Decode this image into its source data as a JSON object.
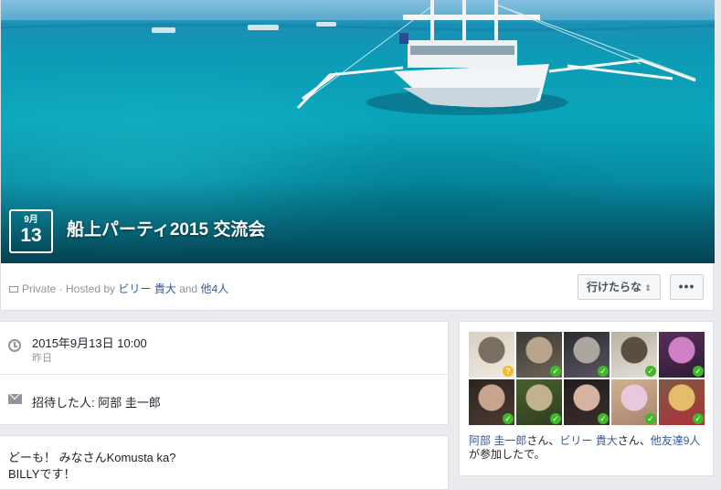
{
  "event": {
    "month": "9月",
    "day": "13",
    "title": "船上パーティ2015 交流会",
    "privacy": "Private · Hosted by",
    "host_name": "ビリー 貴大",
    "host_and": "and",
    "host_others": "他4人",
    "going_button": "行けたらな",
    "going_caret": "⇕",
    "more_button": "•••"
  },
  "details": {
    "date_main": "2015年9月13日 10:00",
    "date_sub": "昨日",
    "invited_by": "招待した人: 阿部 圭一郎"
  },
  "post": {
    "line1": "どーも！ みなさんKomusta ka?",
    "line2": "BILLYです！"
  },
  "friends": {
    "thumbs": [
      {
        "status": "maybe",
        "badge": "?",
        "colors": [
          "#d8d1c2",
          "#7a6f62",
          "#efe9df"
        ]
      },
      {
        "status": "going",
        "badge": "✓",
        "colors": [
          "#3b3a35",
          "#b9a48c",
          "#6c6457"
        ]
      },
      {
        "status": "going",
        "badge": "✓",
        "colors": [
          "#2a2a30",
          "#ada6a0",
          "#5a5660"
        ]
      },
      {
        "status": "going",
        "badge": "✓",
        "colors": [
          "#b7b1a4",
          "#5a4f3f",
          "#e5e1d8"
        ]
      },
      {
        "status": "going",
        "badge": "✓",
        "colors": [
          "#5a2e5c",
          "#d17fc7",
          "#2c1c34"
        ]
      },
      {
        "status": "going",
        "badge": "✓",
        "colors": [
          "#2d2420",
          "#c8a48f",
          "#4a3b33"
        ]
      },
      {
        "status": "going",
        "badge": "✓",
        "colors": [
          "#46612c",
          "#c1b18c",
          "#2f3d22"
        ]
      },
      {
        "status": "going",
        "badge": "✓",
        "colors": [
          "#1f1c1d",
          "#d7b2a1",
          "#3d2e2b"
        ]
      },
      {
        "status": "going",
        "badge": "✓",
        "colors": [
          "#d2b18e",
          "#e8c8dc",
          "#a9826f"
        ]
      },
      {
        "status": "going",
        "badge": "✓",
        "colors": [
          "#7d5a44",
          "#e4bd6a",
          "#b02f3a"
        ]
      }
    ],
    "name1": "阿部 圭一郎",
    "san1": "さん、",
    "name2": "ビリー 貴大",
    "san2": "さん、",
    "others": "他友達9人",
    "suffix": "が参加したで。"
  }
}
